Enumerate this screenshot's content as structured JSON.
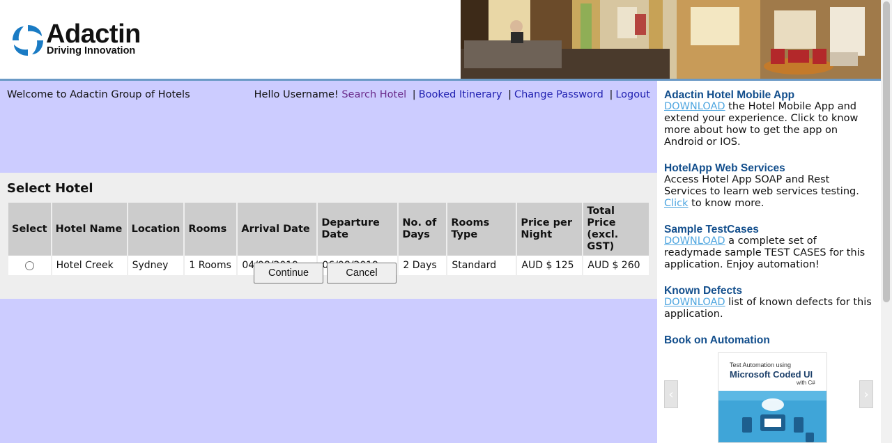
{
  "brand": {
    "name": "Adactin",
    "tagline": "Driving Innovation"
  },
  "colors": {
    "main_bg": "#ccccff",
    "panel_bg": "#eeeeee",
    "header_border": "#6b9ac6",
    "link": "#1f1fb0",
    "link_visited": "#6a2a8a",
    "side_title": "#124e8c",
    "side_link": "#4fa6e0"
  },
  "topbar": {
    "welcome": "Welcome to Adactin Group of Hotels",
    "greeting": "Hello Username!",
    "nav": {
      "search_hotel": "Search Hotel",
      "booked_itinerary": "Booked Itinerary",
      "change_password": "Change Password",
      "logout": "Logout",
      "separator": "|"
    }
  },
  "select_hotel": {
    "title": "Select Hotel",
    "columns": [
      "Select",
      "Hotel Name",
      "Location",
      "Rooms",
      "Arrival Date",
      "Departure Date",
      "No. of Days",
      "Rooms Type",
      "Price per Night",
      "Total Price (excl. GST)"
    ],
    "rows": [
      {
        "selected": false,
        "hotel_name": "Hotel Creek",
        "location": "Sydney",
        "rooms": "1 Rooms",
        "arrival_date": "04/08/2019",
        "departure_date": "06/08/2019",
        "no_of_days": "2 Days",
        "rooms_type": "Standard",
        "price_per_night": "AUD $ 125",
        "total_price": "AUD $ 260"
      }
    ],
    "buttons": {
      "continue": "Continue",
      "cancel": "Cancel"
    }
  },
  "sidebar": {
    "mobile_app": {
      "title": "Adactin Hotel Mobile App",
      "link": "DOWNLOAD",
      "text": " the Hotel Mobile App and extend your experience. Click to know more about how to get the app on Android or IOS."
    },
    "web_services": {
      "title": "HotelApp Web Services",
      "text_before": "Access Hotel App SOAP and Rest Services to learn web services testing. ",
      "link": "Click",
      "text_after": " to know more."
    },
    "test_cases": {
      "title": "Sample TestCases",
      "link": "DOWNLOAD",
      "text": " a complete set of readymade sample TEST CASES for this application. Enjoy automation!"
    },
    "known_defects": {
      "title": "Known Defects",
      "link": "DOWNLOAD",
      "text": " list of known defects for this application."
    },
    "book": {
      "title": "Book on Automation",
      "cover_small": "Test Automation using",
      "cover_big": "Microsoft Coded UI",
      "cover_lang": "with C#",
      "prev_icon": "chevron-left-icon",
      "next_icon": "chevron-right-icon"
    }
  }
}
